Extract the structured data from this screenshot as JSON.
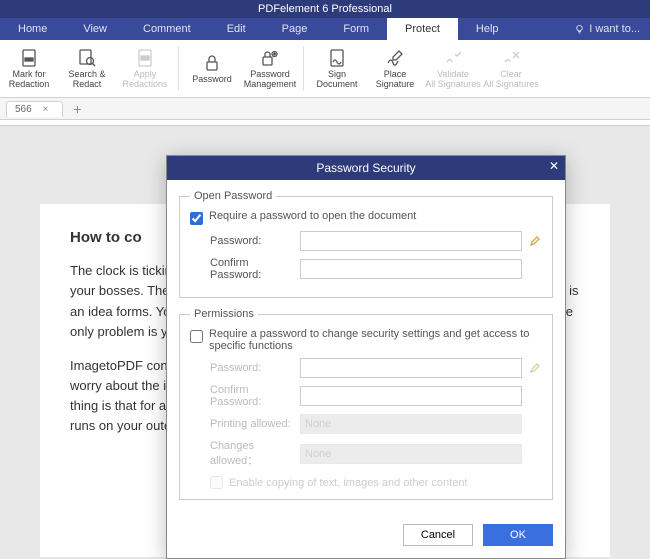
{
  "app": {
    "title": "PDFelement 6 Professional"
  },
  "menu": {
    "items": [
      "Home",
      "View",
      "Comment",
      "Edit",
      "Page",
      "Form",
      "Protect",
      "Help"
    ],
    "active": "Protect",
    "iwant": "I want to..."
  },
  "ribbon": {
    "mark_for_redaction": "Mark for\nRedaction",
    "search_redact": "Search &\nRedact",
    "apply_redactions": "Apply\nRedactions",
    "password": "Password",
    "password_management": "Password\nManagement",
    "sign_document": "Sign\nDocument",
    "place_signature": "Place\nSignature",
    "validate_all": "Validate\nAll Signatures",
    "clear_all": "Clear\nAll Signatures"
  },
  "tabs": {
    "current": "566",
    "close": "×",
    "add": "+"
  },
  "document": {
    "heading": "How to co",
    "para1": "The clock is ticking. You're running out of time and you have to send an image file to your bosses. They might not have their phone or their laptop on them and all you have is an idea forms. You'll change the image to a PDF file, since you can open PDF files. The only problem is you don't know your image has to look perfect.",
    "para2": "ImagetoPDF converts any image file to PDF files every time for free. You don't have to worry about the image dimensions or downloading any to PDF software. And the best thing is that for all digital work there is data and security. This is due to the fact that it runs on your outer and only within the software or graphical plugins."
  },
  "dialog": {
    "title": "Password Security",
    "open": {
      "legend": "Open Password",
      "require": "Require a password to open the document",
      "password": "Password:",
      "confirm": "Confirm Password:"
    },
    "perm": {
      "legend": "Permissions",
      "require": "Require a password to change security settings and get access to specific functions",
      "password": "Password:",
      "confirm": "Confirm Password:",
      "printing": "Printing allowed:",
      "printing_value": "None",
      "changes": "Changes allowed：",
      "changes_value": "None",
      "enable_copy": "Enable copying of text, images and other content"
    },
    "cancel": "Cancel",
    "ok": "OK"
  }
}
